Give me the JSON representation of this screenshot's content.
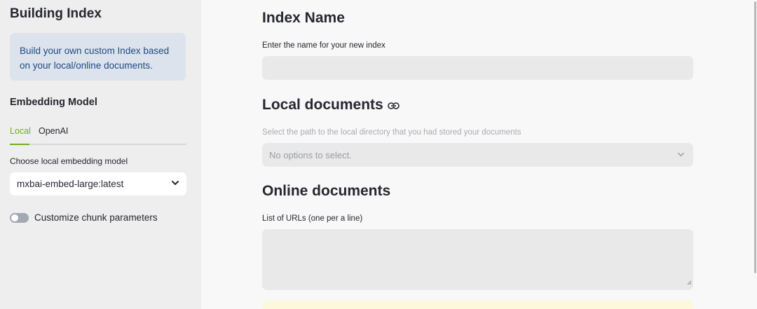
{
  "sidebar": {
    "title": "Building Index",
    "info_text": "Build your own custom Index based on your local/online documents.",
    "embedding_heading": "Embedding Model",
    "tabs": [
      {
        "label": "Local",
        "active": true
      },
      {
        "label": "OpenAI",
        "active": false
      }
    ],
    "model_label": "Choose local embedding model",
    "model_value": "mxbai-embed-large:latest",
    "toggle_label": "Customize chunk parameters",
    "toggle_on": false
  },
  "main": {
    "index_name": {
      "heading": "Index Name",
      "label": "Enter the name for your new index",
      "value": ""
    },
    "local_docs": {
      "heading": "Local documents",
      "label": "Select the path to the local directory that you had stored your documents",
      "placeholder": "No options to select."
    },
    "online_docs": {
      "heading": "Online documents",
      "label": "List of URLs (one per a line)",
      "value": ""
    }
  },
  "colors": {
    "accent": "#6fae1c",
    "info_bg": "#dde3ec",
    "info_text": "#1d4a80",
    "warning_bg": "#fdf8dc"
  },
  "icons": [
    "link-icon",
    "chevron-down-icon",
    "resize-handle-icon"
  ]
}
